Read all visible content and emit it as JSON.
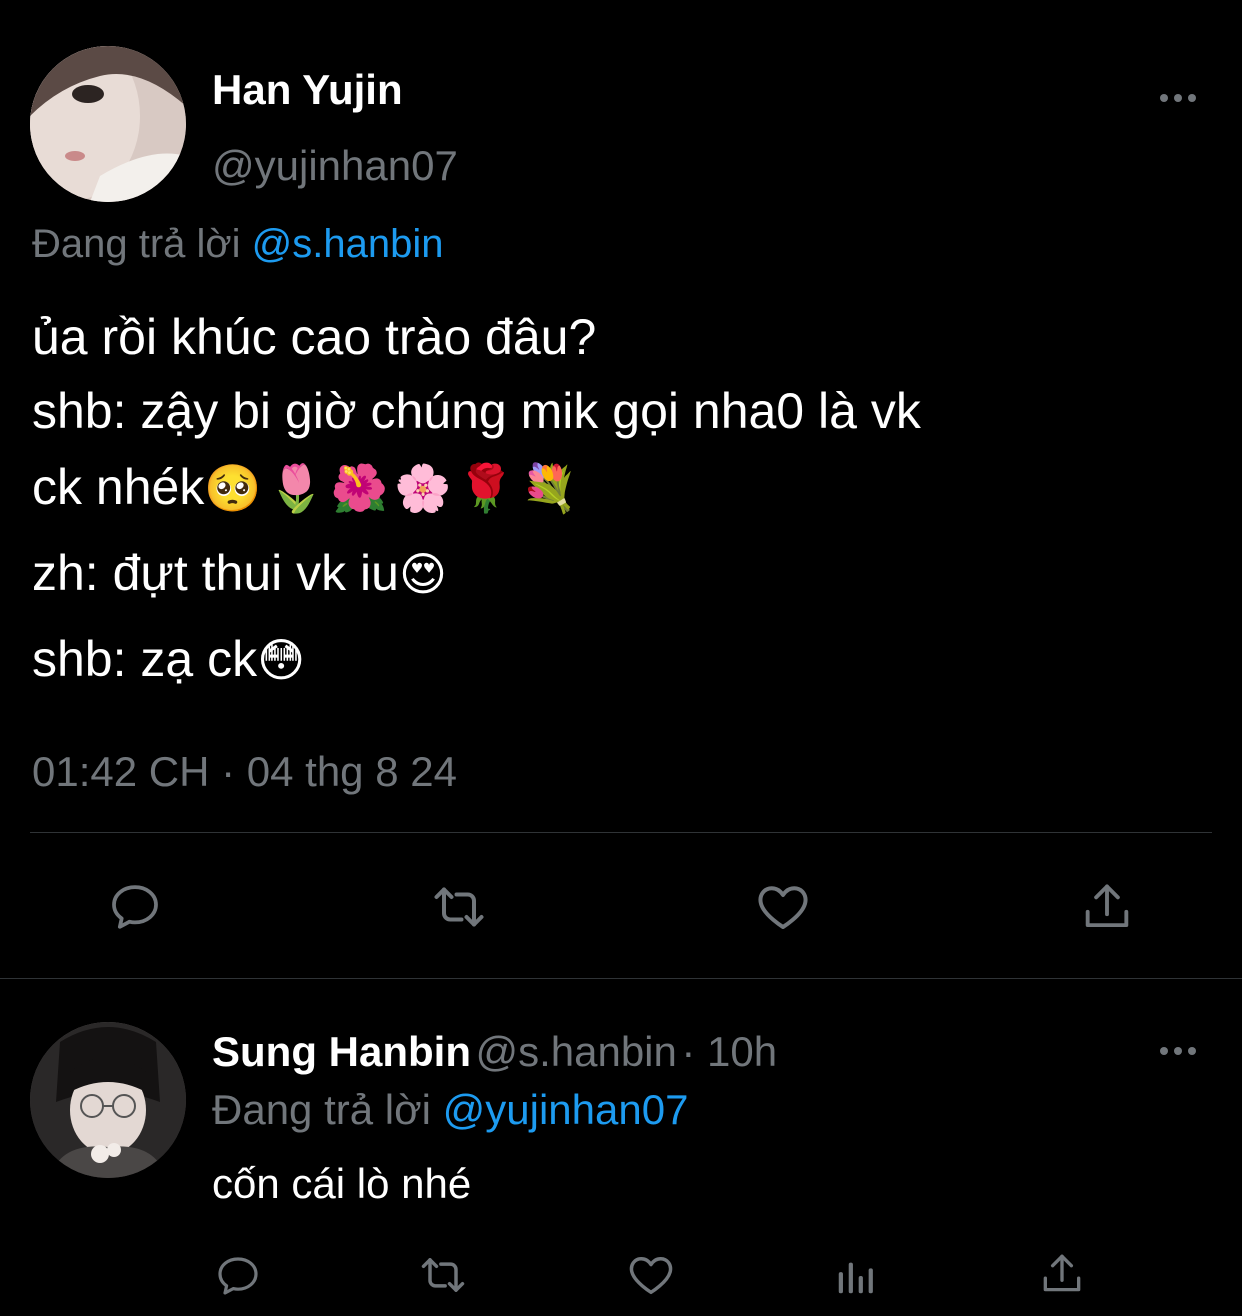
{
  "main_tweet": {
    "display_name": "Han Yujin",
    "handle": "@yujinhan07",
    "replying_prefix": "Đang trả lời",
    "replying_to": "@s.hanbin",
    "lines": [
      "ủa rồi khúc cao trào đâu?",
      "shb: zậy bi giờ chúng mik gọi nha0 là vk",
      "ck nhék",
      "zh: đựt thui vk iu",
      "shb: zạ ck"
    ],
    "emojis": {
      "line3": "🥺🌷🌺🌸🌹💐",
      "line4": "😍",
      "line5": "😳"
    },
    "timestamp": "01:42 CH · 04 thg 8 24",
    "actions": [
      "reply-icon",
      "retweet-icon",
      "like-icon",
      "share-icon"
    ]
  },
  "reply_tweet": {
    "display_name": "Sung Hanbin",
    "handle": "@s.hanbin",
    "time": "· 10h",
    "replying_prefix": "Đang trả lời",
    "replying_to": "@yujinhan07",
    "text": "cốn cái lò nhé",
    "actions": [
      "reply-icon",
      "retweet-icon",
      "like-icon",
      "analytics-icon",
      "share-icon"
    ]
  },
  "colors": {
    "background": "#000000",
    "text": "#ffffff",
    "secondary": "#71767b",
    "accent": "#1d9bf0",
    "divider": "#2f3336"
  }
}
